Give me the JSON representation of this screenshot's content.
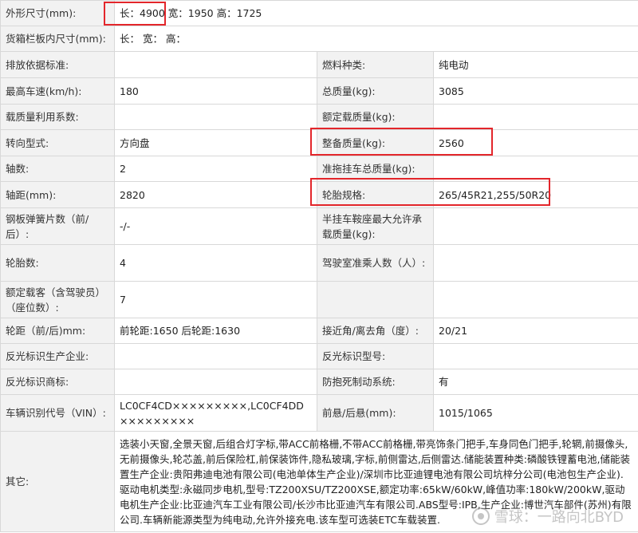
{
  "rows": [
    {
      "label": "外形尺寸(mm):",
      "value": "长：4900 宽：1950 高：1725"
    },
    {
      "label": "货箱栏板内尺寸(mm):",
      "value": "长：  宽：  高："
    },
    {
      "label": "排放依据标准:",
      "value": "",
      "label2": "燃料种类:",
      "value2": "纯电动"
    },
    {
      "label": "最高车速(km/h):",
      "value": "180",
      "label2": "总质量(kg):",
      "value2": "3085"
    },
    {
      "label": "载质量利用系数:",
      "value": "",
      "label2": "额定载质量(kg):",
      "value2": ""
    },
    {
      "label": "转向型式:",
      "value": "方向盘",
      "label2": "整备质量(kg):",
      "value2": "2560"
    },
    {
      "label": "轴数:",
      "value": "2",
      "label2": "准拖挂车总质量(kg):",
      "value2": ""
    },
    {
      "label": "轴距(mm):",
      "value": "2820",
      "label2": "轮胎规格:",
      "value2": "265/45R21,255/50R20"
    },
    {
      "label": "钢板弹簧片数（前/后）:",
      "value": "-/-",
      "label2": "半挂车鞍座最大允许承载质量(kg):",
      "value2": ""
    },
    {
      "label": "轮胎数:",
      "value": "4",
      "label2": "驾驶室准乘人数（人）:",
      "value2": ""
    },
    {
      "label": "额定载客（含驾驶员）（座位数）:",
      "value": "7",
      "label2": "",
      "value2": ""
    },
    {
      "label": "轮距（前/后)mm:",
      "value": "前轮距:1650 后轮距:1630",
      "label2": "接近角/离去角（度）:",
      "value2": "20/21"
    },
    {
      "label": "反光标识生产企业:",
      "value": "",
      "label2": "反光标识型号:",
      "value2": ""
    },
    {
      "label": "反光标识商标:",
      "value": "",
      "label2": "防抱死制动系统:",
      "value2": "有"
    },
    {
      "label": "车辆识别代号（VIN）:",
      "value": "LC0CF4CD×××××××××,LC0CF4DD×××××××××",
      "label2": "前悬/后悬(mm):",
      "value2": "1015/1065"
    },
    {
      "label": "其它:",
      "value": "选装小天窗,全景天窗,后组合灯字标,带ACC前格栅,不带ACC前格栅,带亮饰条门把手,车身同色门把手,轮辋,前摄像头,无前摄像头,轮芯盖,前后保险杠,前保装饰件,隐私玻璃,字标,前侧雷达,后侧雷达.储能装置种类:磷酸铁锂蓄电池,储能装置生产企业:贵阳弗迪电池有限公司(电池单体生产企业)/深圳市比亚迪锂电池有限公司坑梓分公司(电池包生产企业).驱动电机类型:永磁同步电机,型号:TZ200XSU/TZ200XSE,额定功率:65kW/60kW,峰值功率:180kW/200kW,驱动电机生产企业:比亚迪汽车工业有限公司/长沙市比亚迪汽车有限公司.ABS型号:IPB,生产企业:博世汽车部件(苏州)有限公司.车辆新能源类型为纯电动,允许外接充电.该车型可选装ETC车载装置."
    }
  ],
  "watermark": {
    "text": "雪球：一路向北BYD",
    "icon": "xueqiu-logo-icon"
  },
  "highlight_color": "#e3262b"
}
